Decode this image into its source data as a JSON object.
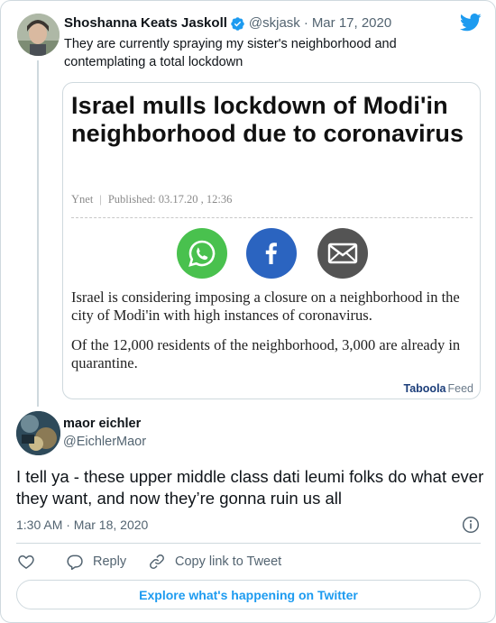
{
  "parent_tweet": {
    "author_name": "Shoshanna Keats Jaskoll",
    "handle": "@skjask",
    "separator": "·",
    "date": "Mar 17, 2020",
    "text": "They are currently spraying my sister's neighborhood and contemplating a total lockdown",
    "verified_icon": "verified-badge-icon",
    "brand_icon": "twitter-bird-icon"
  },
  "article": {
    "title": "Israel mulls lockdown of Modi'in neighborhood due to coronavirus",
    "source": "Ynet",
    "meta_separator": "|",
    "published": "Published: 03.17.20 , 12:36",
    "share_icons": [
      "whatsapp-icon",
      "facebook-icon",
      "email-icon"
    ],
    "paragraph_1": "Israel is considering imposing a closure on a neighborhood in the city of Modi'in with high instances of coronavirus.",
    "paragraph_2": "Of the 12,000 residents of the neighborhood, 3,000 are already in quarantine.",
    "footer_brand": "Taboola",
    "footer_feed": "Feed"
  },
  "reply_tweet": {
    "author_name": "maor eichler",
    "handle": "@EichlerMaor",
    "text": "I tell ya - these upper middle class dati leumi folks do what ever they want, and now they’re gonna ruin us all",
    "timestamp": "1:30 AM · Mar 18, 2020"
  },
  "actions": {
    "like_icon": "heart-icon",
    "reply_label": "Reply",
    "copy_label": "Copy link to Tweet"
  },
  "explore_label": "Explore what's happening on Twitter",
  "colors": {
    "accent": "#1d9bf0",
    "text": "#0f1419",
    "muted": "#536471",
    "border": "#cfd9de",
    "whatsapp": "#49c14e",
    "facebook": "#2b64c0",
    "email": "#545454"
  }
}
